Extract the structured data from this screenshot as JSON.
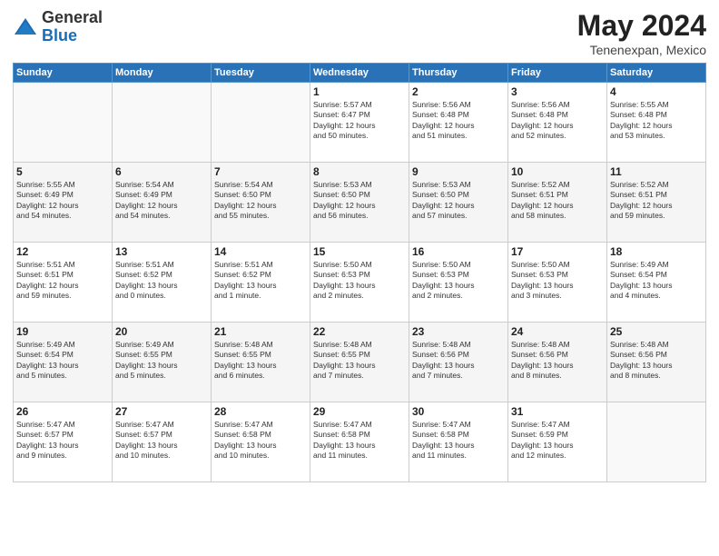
{
  "logo": {
    "general": "General",
    "blue": "Blue"
  },
  "header": {
    "month": "May 2024",
    "location": "Tenenexpan, Mexico"
  },
  "weekdays": [
    "Sunday",
    "Monday",
    "Tuesday",
    "Wednesday",
    "Thursday",
    "Friday",
    "Saturday"
  ],
  "weeks": [
    [
      {
        "day": "",
        "info": ""
      },
      {
        "day": "",
        "info": ""
      },
      {
        "day": "",
        "info": ""
      },
      {
        "day": "1",
        "info": "Sunrise: 5:57 AM\nSunset: 6:47 PM\nDaylight: 12 hours\nand 50 minutes."
      },
      {
        "day": "2",
        "info": "Sunrise: 5:56 AM\nSunset: 6:48 PM\nDaylight: 12 hours\nand 51 minutes."
      },
      {
        "day": "3",
        "info": "Sunrise: 5:56 AM\nSunset: 6:48 PM\nDaylight: 12 hours\nand 52 minutes."
      },
      {
        "day": "4",
        "info": "Sunrise: 5:55 AM\nSunset: 6:48 PM\nDaylight: 12 hours\nand 53 minutes."
      }
    ],
    [
      {
        "day": "5",
        "info": "Sunrise: 5:55 AM\nSunset: 6:49 PM\nDaylight: 12 hours\nand 54 minutes."
      },
      {
        "day": "6",
        "info": "Sunrise: 5:54 AM\nSunset: 6:49 PM\nDaylight: 12 hours\nand 54 minutes."
      },
      {
        "day": "7",
        "info": "Sunrise: 5:54 AM\nSunset: 6:50 PM\nDaylight: 12 hours\nand 55 minutes."
      },
      {
        "day": "8",
        "info": "Sunrise: 5:53 AM\nSunset: 6:50 PM\nDaylight: 12 hours\nand 56 minutes."
      },
      {
        "day": "9",
        "info": "Sunrise: 5:53 AM\nSunset: 6:50 PM\nDaylight: 12 hours\nand 57 minutes."
      },
      {
        "day": "10",
        "info": "Sunrise: 5:52 AM\nSunset: 6:51 PM\nDaylight: 12 hours\nand 58 minutes."
      },
      {
        "day": "11",
        "info": "Sunrise: 5:52 AM\nSunset: 6:51 PM\nDaylight: 12 hours\nand 59 minutes."
      }
    ],
    [
      {
        "day": "12",
        "info": "Sunrise: 5:51 AM\nSunset: 6:51 PM\nDaylight: 12 hours\nand 59 minutes."
      },
      {
        "day": "13",
        "info": "Sunrise: 5:51 AM\nSunset: 6:52 PM\nDaylight: 13 hours\nand 0 minutes."
      },
      {
        "day": "14",
        "info": "Sunrise: 5:51 AM\nSunset: 6:52 PM\nDaylight: 13 hours\nand 1 minute."
      },
      {
        "day": "15",
        "info": "Sunrise: 5:50 AM\nSunset: 6:53 PM\nDaylight: 13 hours\nand 2 minutes."
      },
      {
        "day": "16",
        "info": "Sunrise: 5:50 AM\nSunset: 6:53 PM\nDaylight: 13 hours\nand 2 minutes."
      },
      {
        "day": "17",
        "info": "Sunrise: 5:50 AM\nSunset: 6:53 PM\nDaylight: 13 hours\nand 3 minutes."
      },
      {
        "day": "18",
        "info": "Sunrise: 5:49 AM\nSunset: 6:54 PM\nDaylight: 13 hours\nand 4 minutes."
      }
    ],
    [
      {
        "day": "19",
        "info": "Sunrise: 5:49 AM\nSunset: 6:54 PM\nDaylight: 13 hours\nand 5 minutes."
      },
      {
        "day": "20",
        "info": "Sunrise: 5:49 AM\nSunset: 6:55 PM\nDaylight: 13 hours\nand 5 minutes."
      },
      {
        "day": "21",
        "info": "Sunrise: 5:48 AM\nSunset: 6:55 PM\nDaylight: 13 hours\nand 6 minutes."
      },
      {
        "day": "22",
        "info": "Sunrise: 5:48 AM\nSunset: 6:55 PM\nDaylight: 13 hours\nand 7 minutes."
      },
      {
        "day": "23",
        "info": "Sunrise: 5:48 AM\nSunset: 6:56 PM\nDaylight: 13 hours\nand 7 minutes."
      },
      {
        "day": "24",
        "info": "Sunrise: 5:48 AM\nSunset: 6:56 PM\nDaylight: 13 hours\nand 8 minutes."
      },
      {
        "day": "25",
        "info": "Sunrise: 5:48 AM\nSunset: 6:56 PM\nDaylight: 13 hours\nand 8 minutes."
      }
    ],
    [
      {
        "day": "26",
        "info": "Sunrise: 5:47 AM\nSunset: 6:57 PM\nDaylight: 13 hours\nand 9 minutes."
      },
      {
        "day": "27",
        "info": "Sunrise: 5:47 AM\nSunset: 6:57 PM\nDaylight: 13 hours\nand 10 minutes."
      },
      {
        "day": "28",
        "info": "Sunrise: 5:47 AM\nSunset: 6:58 PM\nDaylight: 13 hours\nand 10 minutes."
      },
      {
        "day": "29",
        "info": "Sunrise: 5:47 AM\nSunset: 6:58 PM\nDaylight: 13 hours\nand 11 minutes."
      },
      {
        "day": "30",
        "info": "Sunrise: 5:47 AM\nSunset: 6:58 PM\nDaylight: 13 hours\nand 11 minutes."
      },
      {
        "day": "31",
        "info": "Sunrise: 5:47 AM\nSunset: 6:59 PM\nDaylight: 13 hours\nand 12 minutes."
      },
      {
        "day": "",
        "info": ""
      }
    ]
  ]
}
